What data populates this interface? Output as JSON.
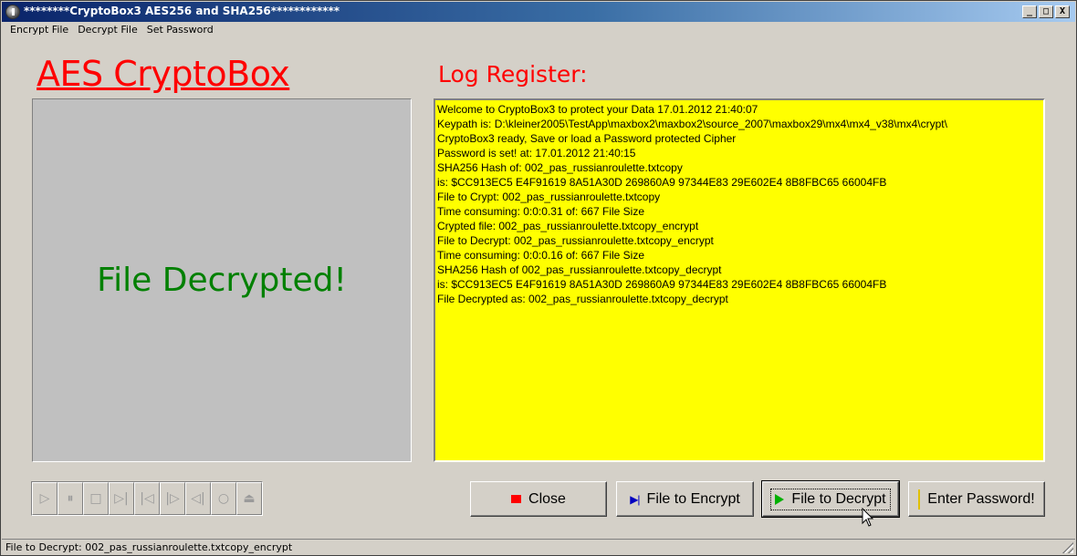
{
  "window": {
    "title": "********CryptoBox3 AES256 and SHA256************",
    "controls": [
      "_",
      "□",
      "X"
    ]
  },
  "menu": [
    "Encrypt File",
    "Decrypt File",
    "Set Password"
  ],
  "left": {
    "title": "AES CryptoBox",
    "display_message": "File Decrypted!"
  },
  "log": {
    "title": "Log Register:",
    "lines": [
      "Welcome to CryptoBox3 to protect your Data 17.01.2012 21:40:07",
      "Keypath is: D:\\kleiner2005\\TestApp\\maxbox2\\maxbox2\\source_2007\\maxbox29\\mx4\\mx4_v38\\mx4\\crypt\\",
      "CryptoBox3 ready, Save or load a Password protected Cipher",
      "Password is set! at: 17.01.2012 21:40:15",
      "SHA256 Hash of: 002_pas_russianroulette.txtcopy",
      "is: $CC913EC5 E4F91619 8A51A30D 269860A9 97344E83 29E602E4 8B8FBC65 66004FB",
      "File to Crypt: 002_pas_russianroulette.txtcopy",
      "Time consuming: 0:0:0.31 of: 667 File Size",
      "Crypted file: 002_pas_russianroulette.txtcopy_encrypt",
      "File to Decrypt: 002_pas_russianroulette.txtcopy_encrypt",
      "Time consuming: 0:0:0.16 of: 667 File Size",
      "SHA256 Hash of 002_pas_russianroulette.txtcopy_decrypt",
      "is: $CC913EC5 E4F91619 8A51A30D 269860A9 97344E83 29E602E4 8B8FBC65 66004FB",
      "File Decrypted as: 002_pas_russianroulette.txtcopy_decrypt"
    ]
  },
  "media_player": {
    "buttons": [
      {
        "name": "play-icon",
        "glyph": "▷"
      },
      {
        "name": "pause-icon",
        "glyph": "⏸"
      },
      {
        "name": "stop-icon",
        "glyph": "□"
      },
      {
        "name": "next-icon",
        "glyph": "▷|"
      },
      {
        "name": "back-icon",
        "glyph": "|◁"
      },
      {
        "name": "step-icon",
        "glyph": "|▷"
      },
      {
        "name": "step-back-icon",
        "glyph": "◁|"
      },
      {
        "name": "record-icon",
        "glyph": "○"
      },
      {
        "name": "eject-icon",
        "glyph": "⏏"
      }
    ]
  },
  "buttons": {
    "close": "Close",
    "encrypt": "File to Encrypt",
    "decrypt": "File to Decrypt",
    "password": "Enter Password!"
  },
  "status": "File to Decrypt: 002_pas_russianroulette.txtcopy_encrypt",
  "colors": {
    "title_red": "#ff0000",
    "decrypted_green": "#008000",
    "log_background": "#ffff00",
    "window_face": "#d4d0c8"
  }
}
